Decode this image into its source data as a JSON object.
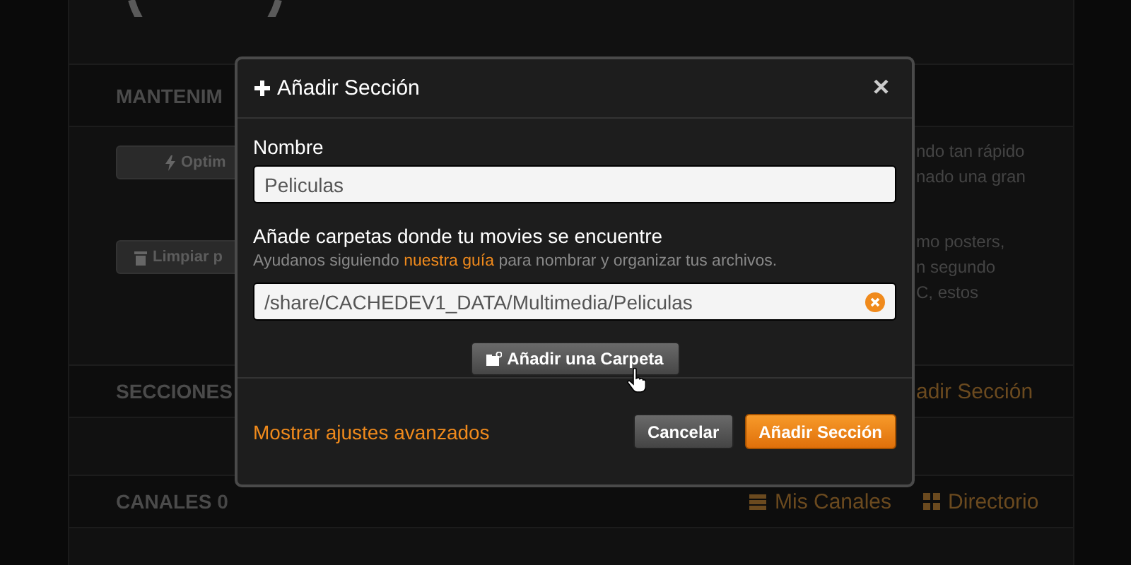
{
  "background": {
    "maintenance": {
      "heading": "MANTENIM",
      "buttons": [
        {
          "label": "Optim"
        },
        {
          "label": "Limpiar p"
        }
      ],
      "descriptions": [
        [
          "ndo tan rápido",
          "nado una gran"
        ],
        [
          "mo posters,",
          "n segundo",
          "C, estos"
        ]
      ]
    },
    "sections": {
      "heading": "SECCIONES",
      "link": "adir Sección"
    },
    "channels": {
      "heading": "CANALES",
      "count": "0",
      "links": [
        {
          "label": "Mis Canales"
        },
        {
          "label": "Directorio"
        }
      ]
    }
  },
  "dialog": {
    "title": "Añadir Sección",
    "close": "×",
    "name_label": "Nombre",
    "name_value": "Peliculas",
    "folders_label": "Añade carpetas donde tu movies se encuentre",
    "folders_hint": {
      "before": "Ayudanos siguiendo ",
      "link": "nuestra guía",
      "after": " para nombrar y organizar tus archivos."
    },
    "folders": [
      {
        "path": "/share/CACHEDEV1_DATA/Multimedia/Peliculas"
      }
    ],
    "add_folder_button": "Añadir una Carpeta",
    "advanced_link": "Mostrar ajustes avanzados",
    "buttons": [
      {
        "kind": "secondary",
        "label": "Cancelar"
      },
      {
        "kind": "primary",
        "label": "Añadir Sección"
      }
    ]
  }
}
